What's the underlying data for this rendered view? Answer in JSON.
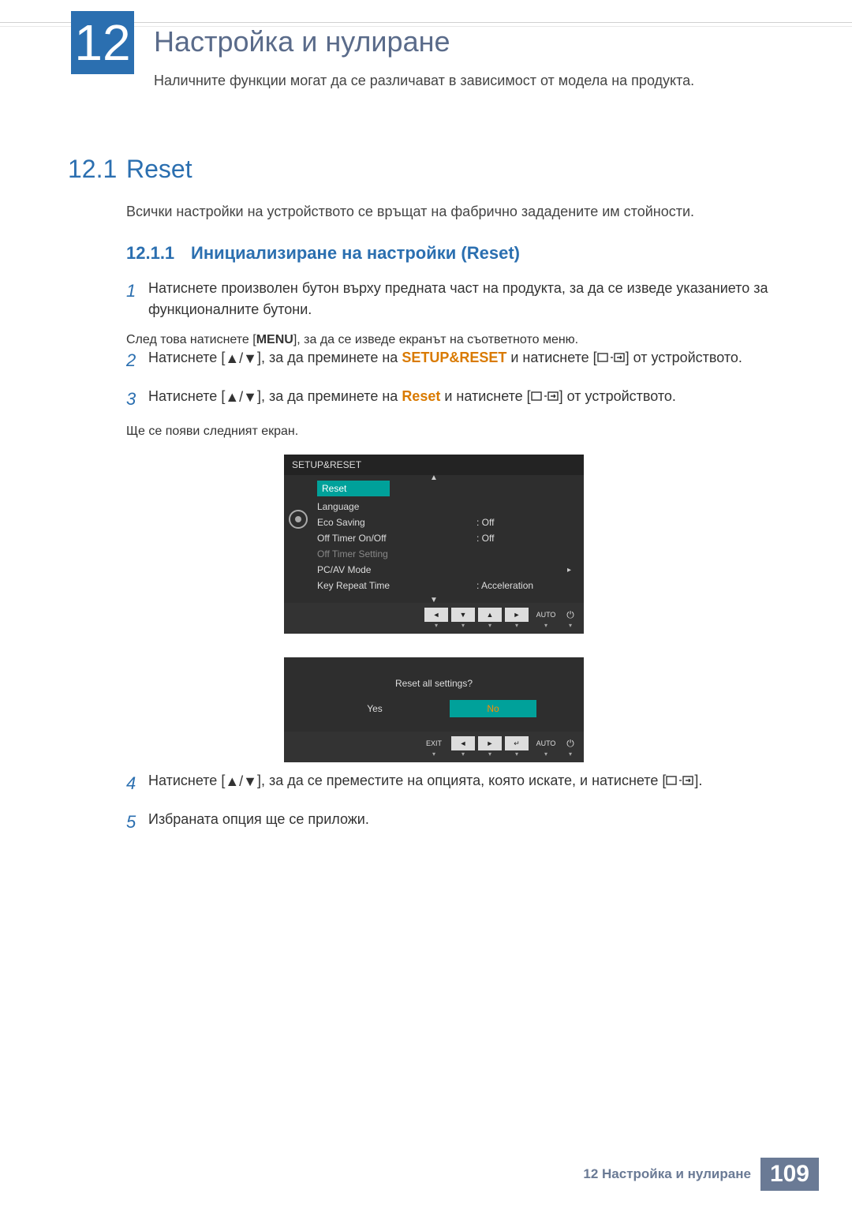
{
  "chapter": {
    "number": "12",
    "title": "Настройка и нулиране",
    "intro": "Наличните функции могат да се различават в зависимост от модела на продукта."
  },
  "section": {
    "number": "12.1",
    "title": "Reset",
    "desc": "Всички настройки на устройството се връщат на фабрично зададените им стойности."
  },
  "subsection": {
    "number": "12.1.1",
    "title": "Инициализиране на настройки (Reset)"
  },
  "steps": {
    "s1": {
      "n": "1",
      "text": "Натиснете произволен бутон върху предната част на продукта, за да се изведе указанието за функционалните бутони.",
      "sub_a": "След това натиснете [",
      "sub_menu": "MENU",
      "sub_b": "], за да се изведе екранът на съответното меню."
    },
    "s2": {
      "n": "2",
      "a": "Натиснете [",
      "b": "], за да преминете на ",
      "kw": "SETUP&RESET",
      "c": " и натиснете [",
      "d": "] от устройството."
    },
    "s3": {
      "n": "3",
      "a": "Натиснете [",
      "b": "], за да преминете на ",
      "kw": "Reset",
      "c": " и натиснете [",
      "d": "] от устройството.",
      "sub": "Ще се появи следният екран."
    },
    "s4": {
      "n": "4",
      "a": "Натиснете [",
      "b": "], за да се преместите на опцията, която искате, и натиснете [",
      "c": "]."
    },
    "s5": {
      "n": "5",
      "text": "Избраната опция ще се приложи."
    }
  },
  "osd": {
    "header": "SETUP&RESET",
    "items": {
      "reset": "Reset",
      "language": "Language",
      "eco": "Eco Saving",
      "eco_val": "Off",
      "timer": "Off Timer On/Off",
      "timer_val": "Off",
      "timerset": "Off Timer Setting",
      "pcav": "PC/AV Mode",
      "repeat": "Key Repeat Time",
      "repeat_val": "Acceleration"
    },
    "bar": {
      "auto": "AUTO"
    }
  },
  "osd2": {
    "prompt": "Reset all settings?",
    "yes": "Yes",
    "no": "No",
    "exit": "EXIT"
  },
  "footer": {
    "text": "12 Настройка и нулиране",
    "page": "109"
  }
}
